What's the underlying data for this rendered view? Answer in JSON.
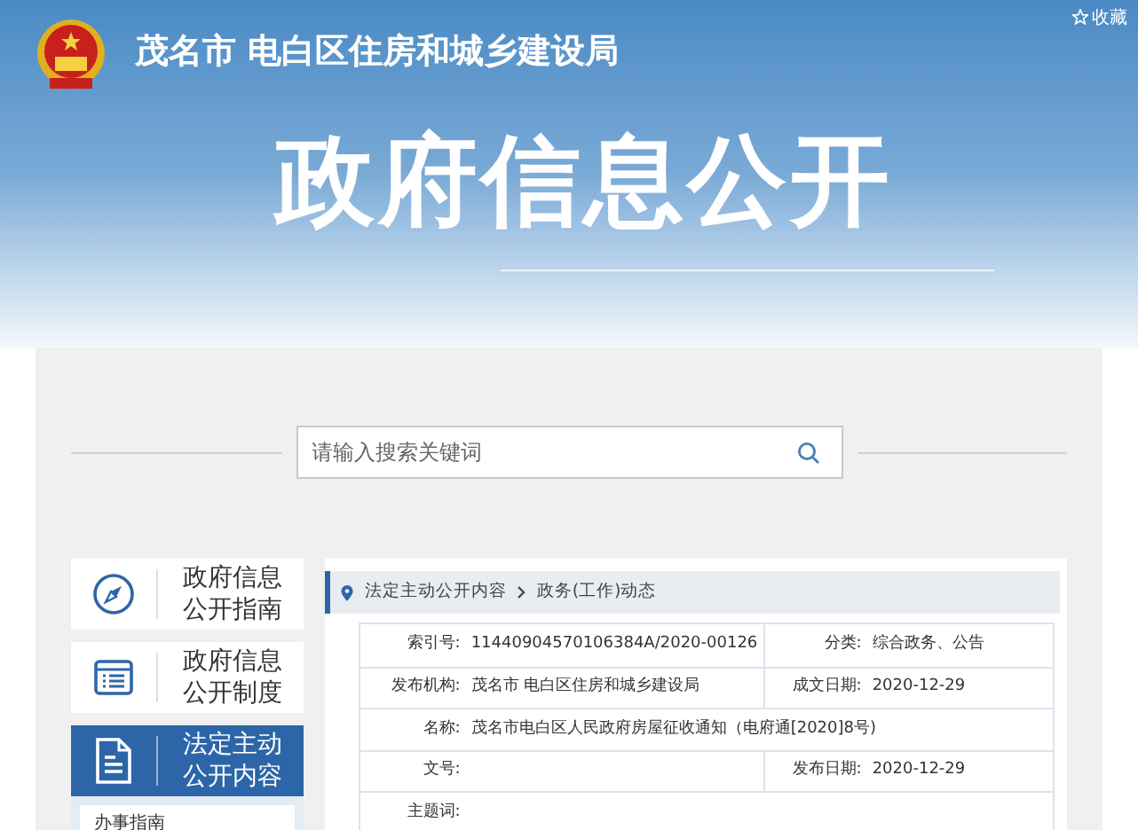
{
  "header": {
    "site_name": "茂名市 电白区住房和城乡建设局",
    "favorite": "收藏",
    "title": "政府信息公开"
  },
  "search": {
    "placeholder": "请输入搜索关键词"
  },
  "sidebar": {
    "items": [
      {
        "kind": "compass",
        "label": "政府信息公开指南",
        "selected": false
      },
      {
        "kind": "list",
        "label": "政府信息公开制度",
        "selected": false
      },
      {
        "kind": "document",
        "label": "法定主动公开内容",
        "selected": true
      }
    ],
    "submenu": [
      "办事指南"
    ]
  },
  "breadcrumb": [
    "法定主动公开内容",
    "政务(工作)动态"
  ],
  "details": [
    [
      {
        "label": "索引号:",
        "value": "11440904570106384A/2020-00126"
      },
      {
        "label": "分类:",
        "value": "综合政务、公告"
      }
    ],
    [
      {
        "label": "发布机构:",
        "value": "茂名市 电白区住房和城乡建设局"
      },
      {
        "label": "成文日期:",
        "value": "2020-12-29"
      }
    ],
    [
      {
        "label": "名称:",
        "value": "茂名市电白区人民政府房屋征收通知（电府通[2020]8号)"
      }
    ],
    [
      {
        "label": "文号:"
      },
      {
        "label": "发布日期:",
        "value": "2020-12-29"
      }
    ],
    [
      {
        "label": "主题词:"
      }
    ]
  ]
}
